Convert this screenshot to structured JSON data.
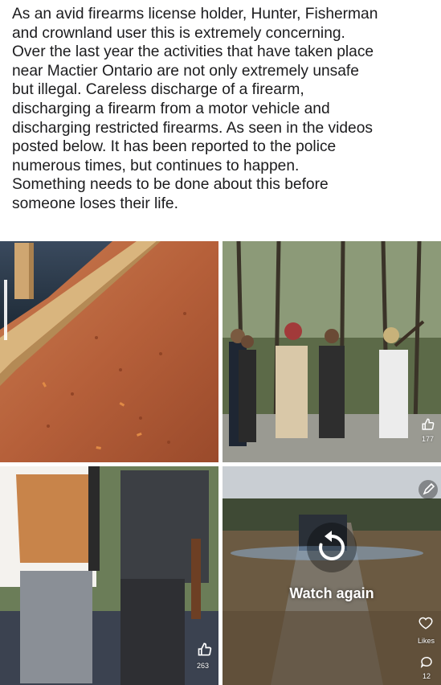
{
  "post": {
    "lines": [
      "As an avid firearms license holder, Hunter, Fisherman",
      "and crownland user this is extremely concerning.",
      "Over the last year the activities that have taken place",
      "near Mactier Ontario are not only extremely unsafe",
      "but illegal. Careless discharge of a firearm,",
      "discharging a firearm from a motor vehicle and",
      "discharging restricted firearms. As seen in the videos",
      "posted below. It has been reported to the police",
      "numerous times, but continues to happen.",
      "Something needs to be done about this before",
      "someone loses their life."
    ]
  },
  "media": {
    "tile2": {
      "like_icon": "thumbs-up-icon",
      "like_count": "177"
    },
    "tile3": {
      "like_icon": "thumbs-up-icon",
      "like_count": "263"
    },
    "tile4": {
      "replay_icon": "replay-icon",
      "watch_again_label": "Watch again",
      "likes_label": "Likes",
      "comment_count": "12",
      "heart_icon": "heart-icon",
      "comment_icon": "comment-icon",
      "pencil_icon": "pencil-icon"
    }
  },
  "colors": {
    "text": "#1c1c1e",
    "overlay_text": "#ffffff",
    "dirt": "#b5623a",
    "wood": "#d8b27a",
    "forest": "#4f5a3a"
  }
}
